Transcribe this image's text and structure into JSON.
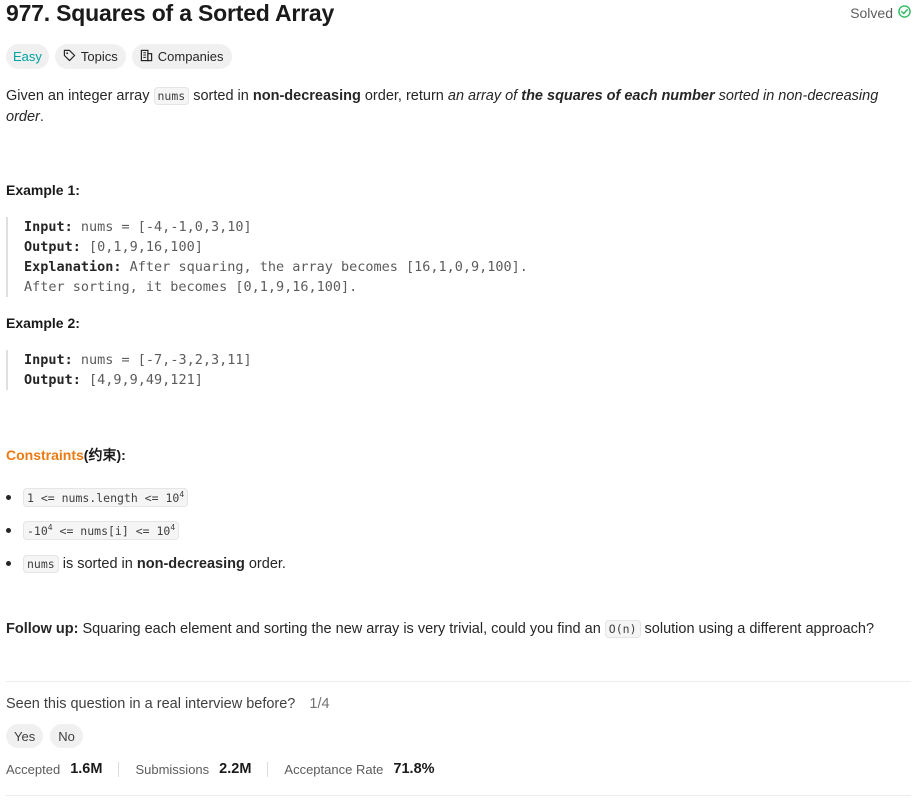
{
  "problem": {
    "title": "977. Squares of a Sorted Array",
    "status": "Solved",
    "difficulty": "Easy",
    "topics_label": "Topics",
    "companies_label": "Companies"
  },
  "description": {
    "p1": "Given an integer array ",
    "p1_code": "nums",
    "p2": " sorted in ",
    "p2_bold": "non-decreasing",
    "p3": " order, return ",
    "p3_italic": "an array of ",
    "p3_bolditalic": "the squares of each number",
    "p3_italic2": " sorted in non-decreasing order",
    "p4": "."
  },
  "examples": [
    {
      "heading": "Example 1:",
      "input_label": "Input:",
      "input": " nums = [-4,-1,0,3,10]",
      "output_label": "Output:",
      "output": " [0,1,9,16,100]",
      "explanation_label": "Explanation:",
      "explanation": " After squaring, the array becomes [16,1,0,9,100].",
      "explanation2": "After sorting, it becomes [0,1,9,16,100]."
    },
    {
      "heading": "Example 2:",
      "input_label": "Input:",
      "input": " nums = [-7,-3,2,3,11]",
      "output_label": "Output:",
      "output": " [4,9,9,49,121]"
    }
  ],
  "constraints": {
    "heading": "Constraints",
    "heading_suffix": "(约束):",
    "c1": "1 <= nums.length <= 10",
    "c1_sup": "4",
    "c2a": "-10",
    "c2a_sup": "4",
    "c2b": " <= nums[i] <= 10",
    "c2b_sup": "4",
    "c3_code": "nums",
    "c3_text": " is sorted in ",
    "c3_bold": "non-decreasing",
    "c3_end": " order."
  },
  "follow_up": {
    "label": "Follow up:",
    "text": " Squaring each element and sorting the new array is very trivial, could you find an ",
    "code": "O(n)",
    "end": " solution using a different approach?"
  },
  "survey": {
    "question": "Seen this question in a real interview before?",
    "fraction": "1/4",
    "yes": "Yes",
    "no": "No"
  },
  "stats": {
    "accepted_label": "Accepted",
    "accepted": "1.6M",
    "submissions_label": "Submissions",
    "submissions": "2.2M",
    "rate_label": "Acceptance Rate",
    "rate": "71.8%"
  },
  "colors": {
    "easy": "#00a3a3",
    "solved_check": "#2cbb5d",
    "constraints": "#ed7a12"
  }
}
